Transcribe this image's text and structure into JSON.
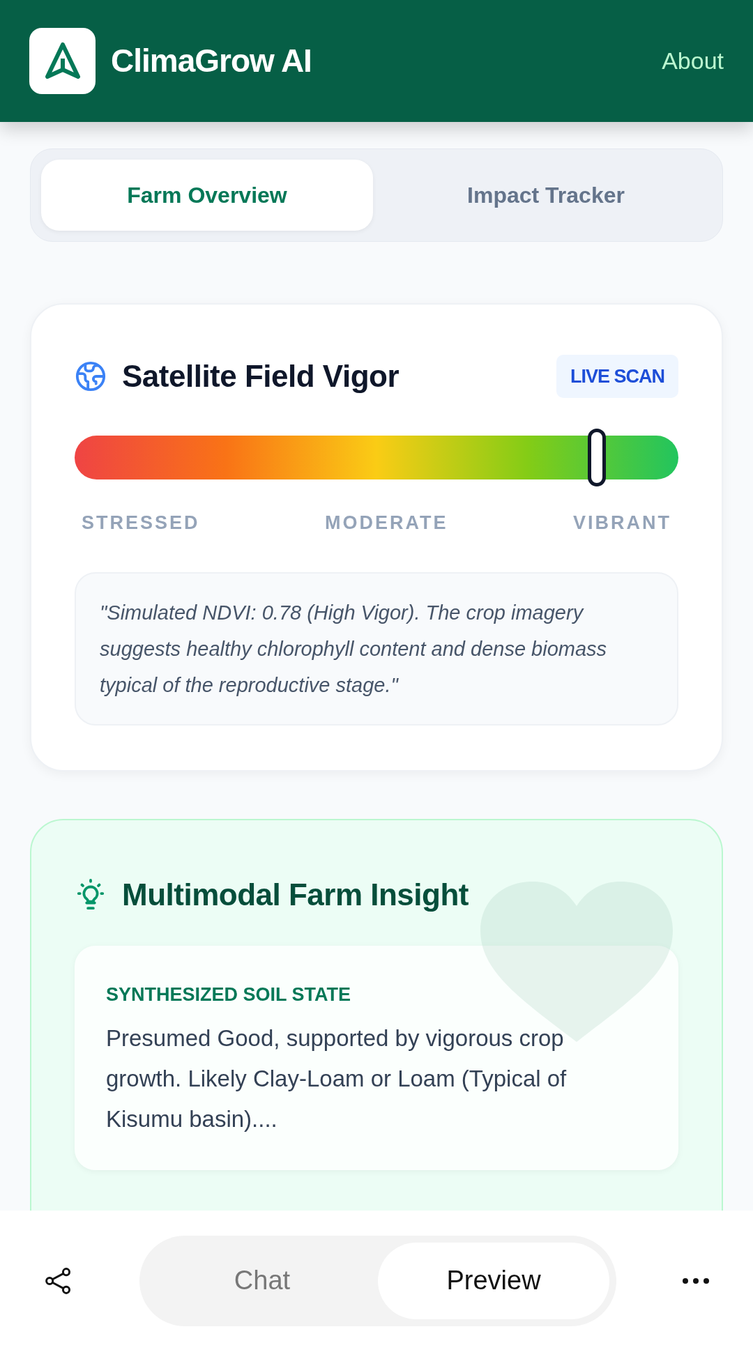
{
  "header": {
    "title": "ClimaGrow AI",
    "link": "About"
  },
  "tabs": [
    {
      "label": "Farm Overview",
      "selected": true
    },
    {
      "label": "Impact Tracker",
      "selected": false
    }
  ],
  "vigor_card": {
    "title": "Satellite Field Vigor",
    "badge": "LIVE SCAN",
    "level": 0.865,
    "scale_labels": [
      "STRESSED",
      "MODERATE",
      "VIBRANT"
    ],
    "quote": "\"Simulated NDVI: 0.78 (High Vigor). The crop imagery suggests healthy chlorophyll content and dense biomass typical of the reproductive stage.\""
  },
  "insight_card": {
    "title": "Multimodal Farm Insight",
    "sections": [
      {
        "label": "SYNTHESIZED SOIL STATE",
        "text": "Presumed Good, supported by vigorous crop growth. Likely Clay-Loam or Loam (Typical of Kisumu basin)...."
      }
    ]
  },
  "bottom_bar": {
    "modes": [
      {
        "label": "Chat",
        "selected": false
      },
      {
        "label": "Preview",
        "selected": true
      }
    ]
  }
}
